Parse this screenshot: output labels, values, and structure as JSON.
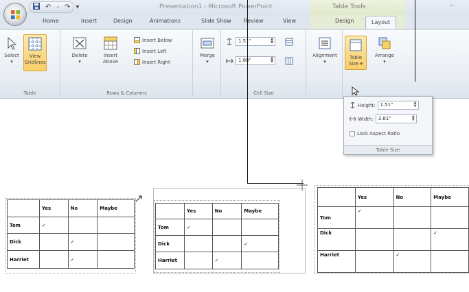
{
  "window": {
    "title": "Presentation1 - Microsoft PowerPoint",
    "context_tab_group": "Table Tools",
    "minimize_glyph": "–"
  },
  "quick_access": {
    "save_icon": "save-icon",
    "undo_glyph": "↶",
    "redo_glyph": "↷",
    "separator": "-",
    "customize_glyph": "▾"
  },
  "tabs": [
    {
      "label": "Home"
    },
    {
      "label": "Insert"
    },
    {
      "label": "Design"
    },
    {
      "label": "Animations"
    },
    {
      "label": "Slide Show"
    },
    {
      "label": "Review"
    },
    {
      "label": "View"
    },
    {
      "label": "Design"
    },
    {
      "label": "Layout"
    }
  ],
  "ribbon": {
    "table_group": {
      "label": "Table",
      "select": "Select",
      "view_gridlines_1": "View",
      "view_gridlines_2": "Gridlines"
    },
    "rows_cols_group": {
      "label": "Rows & Columns",
      "delete": "Delete",
      "insert_above_1": "Insert",
      "insert_above_2": "Above",
      "insert_below": "Insert Below",
      "insert_left": "Insert Left",
      "insert_right": "Insert Right"
    },
    "merge_group": {
      "merge": "Merge"
    },
    "cell_size_group": {
      "label": "Cell Size",
      "height_value": "1.51\"",
      "width_value": "1.86\""
    },
    "alignment": "Alignment",
    "table_size_1": "Table",
    "table_size_2": "Size",
    "arrange": "Arrange",
    "dropdown_glyph": "▾"
  },
  "table_size_popup": {
    "height_label": "Height:",
    "height_value": "1.51\"",
    "width_label": "Width:",
    "width_value": "3.81\"",
    "lock_label": "Lock Aspect Ratio",
    "footer": "Table Size"
  },
  "slide_tables": [
    {
      "headers": [
        "",
        "Yes",
        "No",
        "Maybe"
      ],
      "rows": [
        {
          "name": "Tom",
          "cells": [
            "✓",
            "",
            ""
          ]
        },
        {
          "name": "Dick",
          "cells": [
            "",
            "✓",
            ""
          ]
        },
        {
          "name": "Harriet",
          "cells": [
            "",
            "",
            ""
          ]
        }
      ]
    },
    {
      "headers": [
        "",
        "Yes",
        "No",
        "Maybe"
      ],
      "rows": [
        {
          "name": "Tom",
          "cells": [
            "✓",
            "",
            ""
          ]
        },
        {
          "name": "Dick",
          "cells": [
            "",
            "",
            "✓"
          ]
        },
        {
          "name": "Harriet",
          "cells": [
            "",
            "✓",
            ""
          ]
        }
      ]
    },
    {
      "headers": [
        "",
        "Yes",
        "No",
        "Maybe"
      ],
      "rows": [
        {
          "name": "Tom",
          "cells": [
            "✓",
            "",
            ""
          ]
        },
        {
          "name": "Dick",
          "cells": [
            "",
            "",
            "✓"
          ]
        },
        {
          "name": "Harriet",
          "cells": [
            "",
            "✓",
            ""
          ]
        }
      ]
    }
  ],
  "table1_harriet_check": "✓"
}
